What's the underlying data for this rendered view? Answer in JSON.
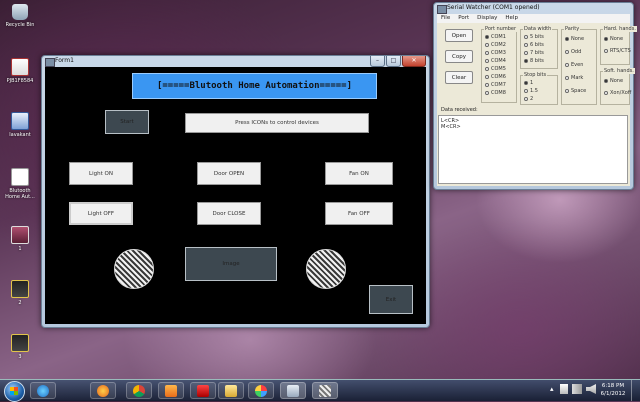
{
  "desktop": {
    "icons": [
      {
        "label": "Recycle Bin",
        "icon": "recycle-bin-icon"
      },
      {
        "label": "PJB1F8584",
        "icon": "pdf-file-icon"
      },
      {
        "label": "lavakant",
        "icon": "word-document-icon"
      },
      {
        "label": "Blutooth Home Aut...",
        "icon": "file-icon"
      },
      {
        "label": "1",
        "icon": "image-icon"
      },
      {
        "label": "2",
        "icon": "image-icon"
      },
      {
        "label": "3",
        "icon": "image-icon"
      }
    ]
  },
  "form1": {
    "title": "Form1",
    "window_controls": {
      "minimize": "–",
      "maximize": "□",
      "close": "✕"
    },
    "banner": "[=====Blutooth Home Automation=====]",
    "start_button": "Start",
    "instruction": "Press ICONs to control devices",
    "buttons": {
      "light_on": "Light ON",
      "door_open": "Door OPEN",
      "fan_on": "Fan ON",
      "light_off": "Light OFF",
      "door_close": "Door CLOSE",
      "fan_off": "Fan OFF",
      "image": "Image",
      "exit": "Exit"
    },
    "colors": {
      "banner_bg": "#3a96f2",
      "client_bg": "#000000"
    }
  },
  "serial_watcher": {
    "title": "Serial Watcher (COM1 opened)",
    "menu": [
      "File",
      "Port",
      "Display",
      "Help"
    ],
    "buttons": {
      "open": "Open",
      "copy": "Copy",
      "clear": "Clear"
    },
    "port_number": {
      "label": "Port number",
      "options": [
        "COM1",
        "COM2",
        "COM3",
        "COM4",
        "COM5",
        "COM6",
        "COM7",
        "COM8"
      ],
      "selected": "COM1"
    },
    "data_width": {
      "label": "Data width",
      "options": [
        "5 bits",
        "6 bits",
        "7 bits",
        "8 bits"
      ],
      "selected": "8 bits"
    },
    "stop_bits": {
      "label": "Stop bits",
      "options": [
        "1",
        "1.5",
        "2"
      ],
      "selected": "1"
    },
    "parity": {
      "label": "Parity",
      "options": [
        "None",
        "Odd",
        "Even",
        "Mark",
        "Space"
      ],
      "selected": "None"
    },
    "hard_handshake": {
      "label": "Hard. hands.",
      "options": [
        "None",
        "RTS/CTS"
      ],
      "selected": "None"
    },
    "soft_handshake": {
      "label": "Soft. hands.",
      "options": [
        "None",
        "Xon/Xoff"
      ],
      "selected": "None"
    },
    "data_received_label": "Data received:",
    "data_received": [
      "L<CR>",
      "M<CR>"
    ]
  },
  "taskbar": {
    "time": "6:18 PM",
    "date": "6/1/2012",
    "items": [
      "start-orb-icon",
      "internet-explorer-icon",
      "firefox-icon",
      "chrome-icon",
      "media-player-icon",
      "acrobat-icon",
      "folder-icon",
      "paint-icon",
      "window-icon",
      "serial-watcher-icon"
    ]
  }
}
